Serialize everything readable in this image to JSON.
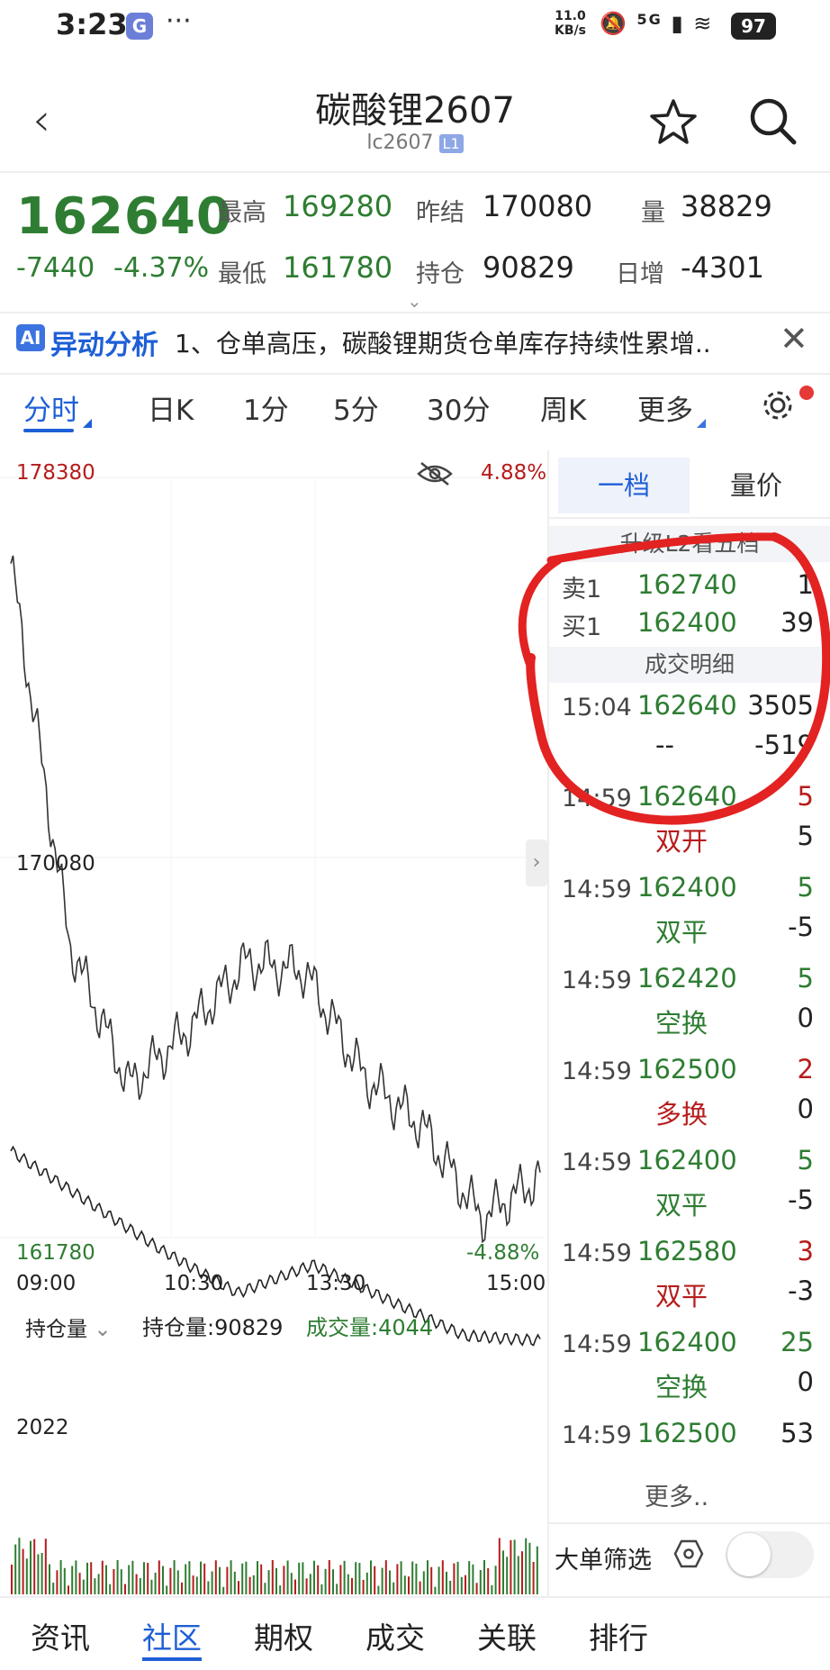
{
  "status_bar": {
    "time": "3:23",
    "app_icon": "G",
    "dots": "···",
    "net_speed_value": "11.0",
    "net_speed_unit": "KB/s",
    "signal": "5G",
    "battery": "97"
  },
  "header": {
    "title": "碳酸锂2607",
    "code": "lc2607",
    "badge": "L1"
  },
  "quote": {
    "last_price": "162640",
    "change": "-7440",
    "change_pct": "-4.37%",
    "high_label": "最高",
    "high": "169280",
    "low_label": "最低",
    "low": "161780",
    "prev_settle_label": "昨结",
    "prev_settle": "170080",
    "open_interest_label": "持仓",
    "open_interest": "90829",
    "volume_label": "量",
    "volume": "38829",
    "daily_change_label": "日增",
    "daily_change": "-4301"
  },
  "ai_banner": {
    "badge": "AI",
    "title": "异动分析",
    "text": "1、仓单高压，碳酸锂期货仓单库存持续性累增.."
  },
  "tabs": [
    {
      "label": "分时"
    },
    {
      "label": "日K"
    },
    {
      "label": "1分"
    },
    {
      "label": "5分"
    },
    {
      "label": "30分"
    },
    {
      "label": "周K"
    },
    {
      "label": "更多"
    }
  ],
  "chart": {
    "top_price": "178380",
    "top_pct": "4.88%",
    "mid_price": "170080",
    "bottom_price": "161780",
    "bottom_pct": "-4.88%",
    "x_labels": [
      "09:00",
      "10:30",
      "13:30",
      "15:00"
    ],
    "sub_selector": "持仓量",
    "sub_oi_label": "持仓量:90829",
    "sub_vol_label": "成交量:4044",
    "sub_left_value": "2022"
  },
  "chart_data": {
    "type": "line",
    "x": [
      "09:00",
      "10:30",
      "13:30",
      "15:00"
    ],
    "ylim": [
      161780,
      178380
    ],
    "series": [
      {
        "values": [
          176500,
          168200,
          165100,
          166300,
          167800,
          167600,
          165300,
          164200,
          162200,
          163100
        ]
      }
    ],
    "open_interest": [
      93500,
      92800,
      92100,
      91500,
      91900,
      91400,
      90900,
      90829
    ]
  },
  "orderbook": {
    "tab_active": "一档",
    "tab_other": "量价",
    "upgrade_text": "升级L2看五档",
    "ask_label": "卖1",
    "ask_price": "162740",
    "ask_vol": "1",
    "bid_label": "买1",
    "bid_price": "162400",
    "bid_vol": "39",
    "trades_header": "成交明细",
    "trades": [
      {
        "time": "15:04",
        "price": "162640",
        "vol": "3505",
        "kind": "--",
        "kind_vol": "-519",
        "price_color": "green",
        "vol_color": "dark",
        "kind_color": "dark"
      },
      {
        "time": "14:59",
        "price": "162640",
        "vol": "5",
        "kind": "双开",
        "kind_vol": "5",
        "price_color": "green",
        "vol_color": "red",
        "kind_color": "red"
      },
      {
        "time": "14:59",
        "price": "162400",
        "vol": "5",
        "kind": "双平",
        "kind_vol": "-5",
        "price_color": "green",
        "vol_color": "green",
        "kind_color": "green"
      },
      {
        "time": "14:59",
        "price": "162420",
        "vol": "5",
        "kind": "空换",
        "kind_vol": "0",
        "price_color": "green",
        "vol_color": "green",
        "kind_color": "green"
      },
      {
        "time": "14:59",
        "price": "162500",
        "vol": "2",
        "kind": "多换",
        "kind_vol": "0",
        "price_color": "green",
        "vol_color": "red",
        "kind_color": "red"
      },
      {
        "time": "14:59",
        "price": "162400",
        "vol": "5",
        "kind": "双平",
        "kind_vol": "-5",
        "price_color": "green",
        "vol_color": "green",
        "kind_color": "green"
      },
      {
        "time": "14:59",
        "price": "162580",
        "vol": "3",
        "kind": "双平",
        "kind_vol": "-3",
        "price_color": "green",
        "vol_color": "red",
        "kind_color": "red"
      },
      {
        "time": "14:59",
        "price": "162400",
        "vol": "25",
        "kind": "空换",
        "kind_vol": "0",
        "price_color": "green",
        "vol_color": "green",
        "kind_color": "green"
      },
      {
        "time": "14:59",
        "price": "162500",
        "vol": "53",
        "kind": "",
        "kind_vol": "",
        "price_color": "green",
        "vol_color": "dark",
        "kind_color": "dark"
      }
    ],
    "more": "更多..",
    "big_order_filter": "大单筛选"
  },
  "bottom_nav": [
    {
      "label": "资讯"
    },
    {
      "label": "社区"
    },
    {
      "label": "期权"
    },
    {
      "label": "成交"
    },
    {
      "label": "关联"
    },
    {
      "label": "排行"
    }
  ],
  "colors": {
    "up": "#b71c1c",
    "down": "#2e7d32",
    "accent": "#1e5fd6",
    "annotation": "#e32222"
  }
}
